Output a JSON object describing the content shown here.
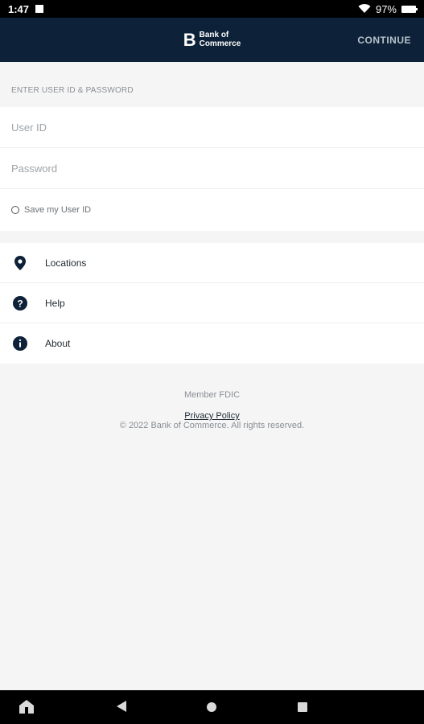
{
  "status": {
    "time": "1:47",
    "battery": "97%"
  },
  "header": {
    "logo_mark": "B",
    "logo_line1": "Bank of",
    "logo_line2": "Commerce",
    "continue_label": "CONTINUE"
  },
  "login": {
    "section_label": "ENTER USER ID & PASSWORD",
    "user_id_placeholder": "User ID",
    "password_placeholder": "Password",
    "save_label": "Save my User ID"
  },
  "menu": {
    "items": [
      {
        "label": "Locations",
        "icon": "location-pin-icon"
      },
      {
        "label": "Help",
        "icon": "question-icon"
      },
      {
        "label": "About",
        "icon": "info-icon"
      }
    ]
  },
  "footer": {
    "member": "Member FDIC",
    "privacy": "Privacy Policy",
    "copyright": "© 2022 Bank of Commerce. All rights reserved."
  },
  "colors": {
    "header_bg": "#0d2238",
    "icon": "#0d2238"
  }
}
